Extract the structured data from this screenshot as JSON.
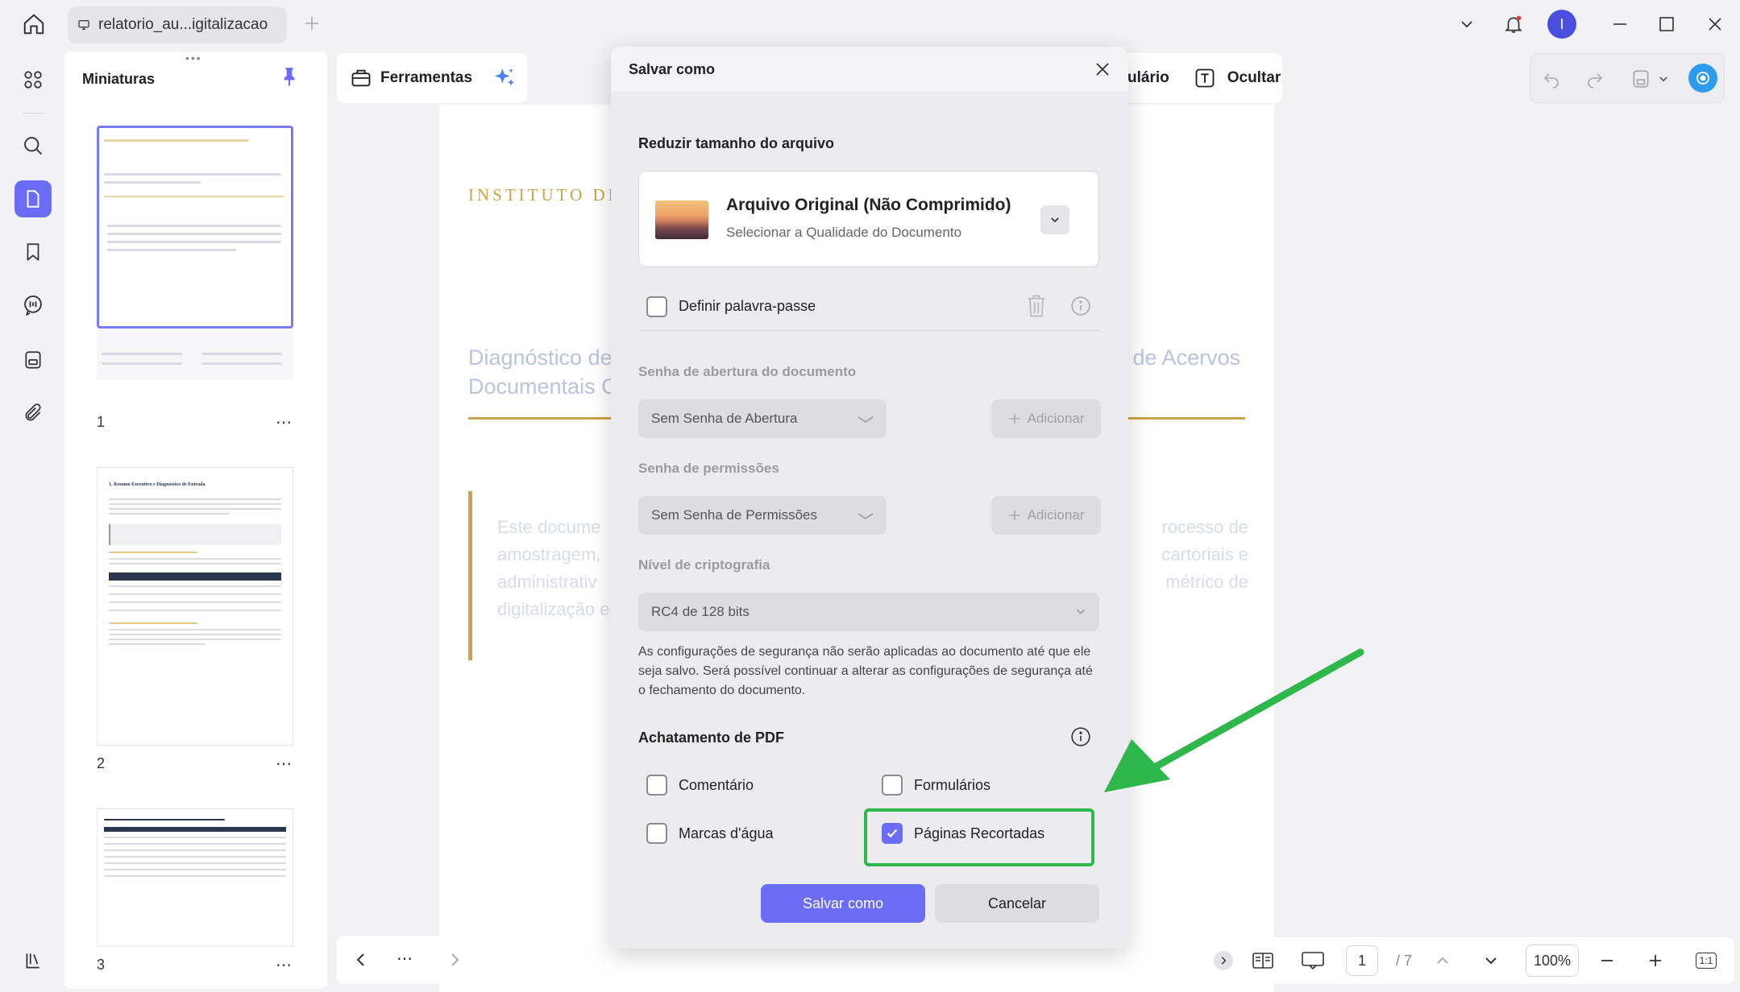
{
  "titlebar": {
    "tab_title": "relatorio_au...igitalizacao",
    "avatar_initial": "I"
  },
  "thumbnails": {
    "title": "Miniaturas",
    "pages": [
      {
        "number": "1"
      },
      {
        "number": "2",
        "heading": "1. Resumo Executivo e Diagnóstico de Entrada"
      },
      {
        "number": "3"
      }
    ],
    "more_glyph": "⋯"
  },
  "toolbar": {
    "tools_label": "Ferramentas",
    "partial_label": "ulário",
    "hide_label": "Ocultar"
  },
  "document": {
    "institute_fragment": "INSTITUTO DE",
    "title_left_line1": "Diagnóstico de",
    "title_left_line2": "Documentais C",
    "title_right": "o de Acervos",
    "para_left": [
      "Este docume",
      "amostragem,",
      "administrativ",
      "digitalização e"
    ],
    "para_right": [
      "rocesso de",
      "cartoriais e",
      "métrico de"
    ]
  },
  "dialog": {
    "title": "Salvar como",
    "reduce_heading": "Reduzir tamanho do arquivo",
    "quality_title": "Arquivo Original (Não Comprimido)",
    "quality_subtitle": "Selecionar a Qualidade do Documento",
    "set_password_label": "Definir palavra-passe",
    "open_password_heading": "Senha de abertura do documento",
    "open_password_value": "Sem Senha de Abertura",
    "add_label": "Adicionar",
    "permissions_heading": "Senha de permissões",
    "permissions_value": "Sem Senha de Permissões",
    "encryption_heading": "Nível de criptografia",
    "encryption_value": "RC4 de 128 bits",
    "note": "As configurações de segurança não serão aplicadas ao documento até que ele seja salvo. Será possível continuar a alterar as configurações de segurança até o fechamento do documento.",
    "flatten_heading": "Achatamento de PDF",
    "flatten_options": [
      {
        "label": "Comentário",
        "checked": false
      },
      {
        "label": "Formulários",
        "checked": false
      },
      {
        "label": "Marcas d'água",
        "checked": false
      },
      {
        "label": "Páginas Recortadas",
        "checked": true
      }
    ],
    "save_label": "Salvar como",
    "cancel_label": "Cancelar"
  },
  "statusbar": {
    "current_page": "1",
    "page_total": "/ 7",
    "zoom": "100%",
    "fit_label": "1:1"
  },
  "colors": {
    "accent": "#6b6cf5",
    "highlight_green": "#2eb84b",
    "gold": "#c9a349"
  }
}
